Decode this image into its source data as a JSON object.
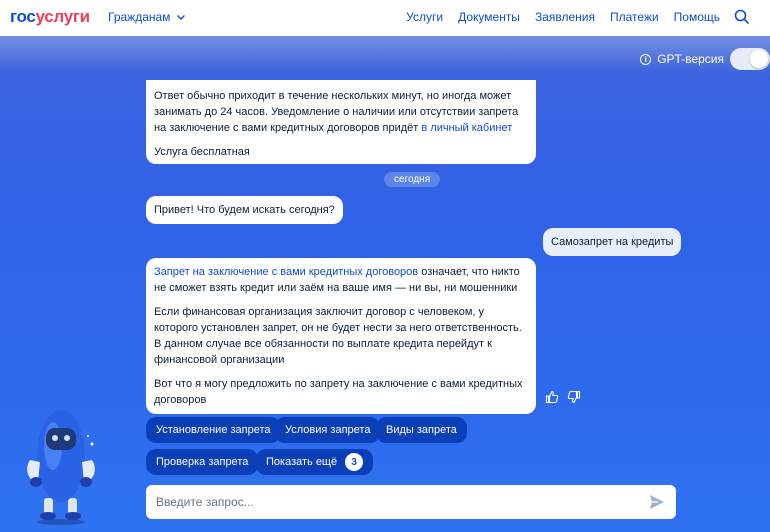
{
  "header": {
    "logo_part1": "гос",
    "logo_part2": "услуги",
    "audience": "Гражданам",
    "nav": [
      "Услуги",
      "Документы",
      "Заявления",
      "Платежи",
      "Помощь"
    ]
  },
  "gpt": {
    "label": "GPT-версия",
    "enabled": false
  },
  "messages": {
    "m1_text_a": "Ответ обычно приходит в течение нескольких минут, но иногда может занимать до 24 часов. Уведомление о наличии или отсутствии запрета на заключение с вами кредитных договоров придёт ",
    "m1_link": "в личный кабинет",
    "m1_free": "Услуга бесплатная",
    "date_separator": "сегодня",
    "m2": "Привет! Что будем искать сегодня?",
    "m3_user": "Самозапрет на кредиты",
    "m4_link": "Запрет на заключение с вами кредитных договоров",
    "m4_text_a": " означает, что никто не сможет взять кредит или заём на ваше имя — ни вы, ни мошенники",
    "m4_p2": "Если финансовая организация заключит договор с человеком, у которого установлен запрет, он не будет нести за него ответственность. В данном случае все обязанности по выплате кредита перейдут к финансовой организации",
    "m4_p3": "Вот что я могу предложить по запрету на заключение с вами кредитных договоров"
  },
  "chips": {
    "c1": "Установление запрета",
    "c2": "Условия запрета",
    "c3": "Виды запрета",
    "c4": "Проверка запрета",
    "c5": "Показать ещё",
    "more_count": "3"
  },
  "input": {
    "placeholder": "Введите запрос..."
  },
  "colors": {
    "brand_blue": "#0d4cd3",
    "brand_red": "#ee3f58",
    "chip_bg": "#0a3fb8"
  },
  "icons": [
    "chevron-down-icon",
    "search-icon",
    "info-icon",
    "thumbs-up-icon",
    "thumbs-down-icon",
    "send-icon"
  ]
}
